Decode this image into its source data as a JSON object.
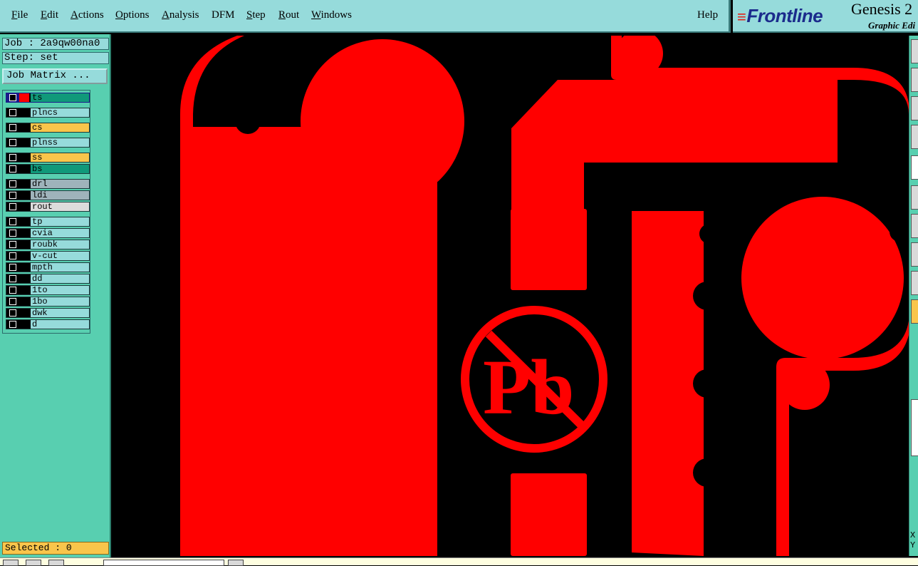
{
  "menu": {
    "items": [
      {
        "label": "File",
        "underline": "F"
      },
      {
        "label": "Edit",
        "underline": "E"
      },
      {
        "label": "Actions",
        "underline": "A"
      },
      {
        "label": "Options",
        "underline": "O"
      },
      {
        "label": "Analysis",
        "underline": "A"
      },
      {
        "label": "DFM",
        "underline": ""
      },
      {
        "label": "Step",
        "underline": "S"
      },
      {
        "label": "Rout",
        "underline": "R"
      },
      {
        "label": "Windows",
        "underline": "W"
      }
    ],
    "help": "Help"
  },
  "brand": {
    "logo_text": "Frontline",
    "title": "Genesis 2",
    "subtitle": "Graphic Edi"
  },
  "job": {
    "job_text": "Job : 2a9qw00na0",
    "step_text": "Step: set",
    "job_matrix_label": "Job Matrix ..."
  },
  "layers": [
    {
      "name": "ts",
      "color": "#10997a",
      "active": true
    },
    {
      "name": "plncs",
      "color": "#96dbdb"
    },
    {
      "name": "cs",
      "color": "#f9c54b"
    },
    {
      "name": "plnss",
      "color": "#96dbdb"
    },
    {
      "name": "ss",
      "color": "#f9c54b"
    },
    {
      "name": "bs",
      "color": "#10997a"
    },
    {
      "name": "drl",
      "color": "#9fb3bb"
    },
    {
      "name": "ldi",
      "color": "#9fb3bb"
    },
    {
      "name": "rout",
      "color": "#dcdcdc"
    },
    {
      "name": "tp",
      "color": "#96dbdb"
    },
    {
      "name": "cvia",
      "color": "#96dbdb"
    },
    {
      "name": "roubk",
      "color": "#96dbdb"
    },
    {
      "name": "v-cut",
      "color": "#96dbdb"
    },
    {
      "name": "mpth",
      "color": "#96dbdb"
    },
    {
      "name": "dd",
      "color": "#96dbdb"
    },
    {
      "name": "1to",
      "color": "#96dbdb"
    },
    {
      "name": "1bo",
      "color": "#96dbdb"
    },
    {
      "name": "dwk",
      "color": "#96dbdb"
    },
    {
      "name": "d",
      "color": "#96dbdb"
    }
  ],
  "status": {
    "selected": "Selected : 0"
  },
  "canvas": {
    "symbol_text": "Pb",
    "copper_color": "#ff0000",
    "background_color": "#000000"
  },
  "coords": {
    "x_label": "X",
    "y_label": "Y"
  },
  "icons": {
    "layer_checkbox": "checkbox-icon",
    "active_color": "color-swatch-icon"
  }
}
